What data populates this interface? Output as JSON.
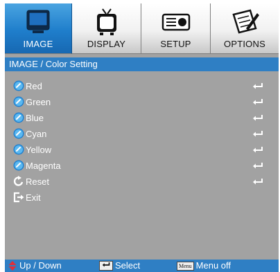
{
  "tabs": [
    {
      "label": "IMAGE",
      "icon": "monitor-icon",
      "active": true
    },
    {
      "label": "DISPLAY",
      "icon": "tv-icon",
      "active": false
    },
    {
      "label": "SETUP",
      "icon": "projector-icon",
      "active": false
    },
    {
      "label": "OPTIONS",
      "icon": "pen-paper-icon",
      "active": false
    }
  ],
  "breadcrumb": "IMAGE / Color Setting",
  "menu_items": [
    {
      "label": "Red",
      "icon": "color-dot-icon",
      "has_enter": true
    },
    {
      "label": "Green",
      "icon": "color-dot-icon",
      "has_enter": true
    },
    {
      "label": "Blue",
      "icon": "color-dot-icon",
      "has_enter": true
    },
    {
      "label": "Cyan",
      "icon": "color-dot-icon",
      "has_enter": true
    },
    {
      "label": "Yellow",
      "icon": "color-dot-icon",
      "has_enter": true
    },
    {
      "label": "Magenta",
      "icon": "color-dot-icon",
      "has_enter": true
    },
    {
      "label": "Reset",
      "icon": "reset-icon",
      "has_enter": true
    },
    {
      "label": "Exit",
      "icon": "exit-icon",
      "has_enter": false
    }
  ],
  "footer": {
    "updown_label": "Up / Down",
    "select_label": "Select",
    "menu_key": "Menu",
    "menu_label": "Menu off"
  },
  "colors": {
    "accent": "#2f7fc4",
    "panel": "#a2a2a2",
    "arrow": "#e0303a"
  }
}
